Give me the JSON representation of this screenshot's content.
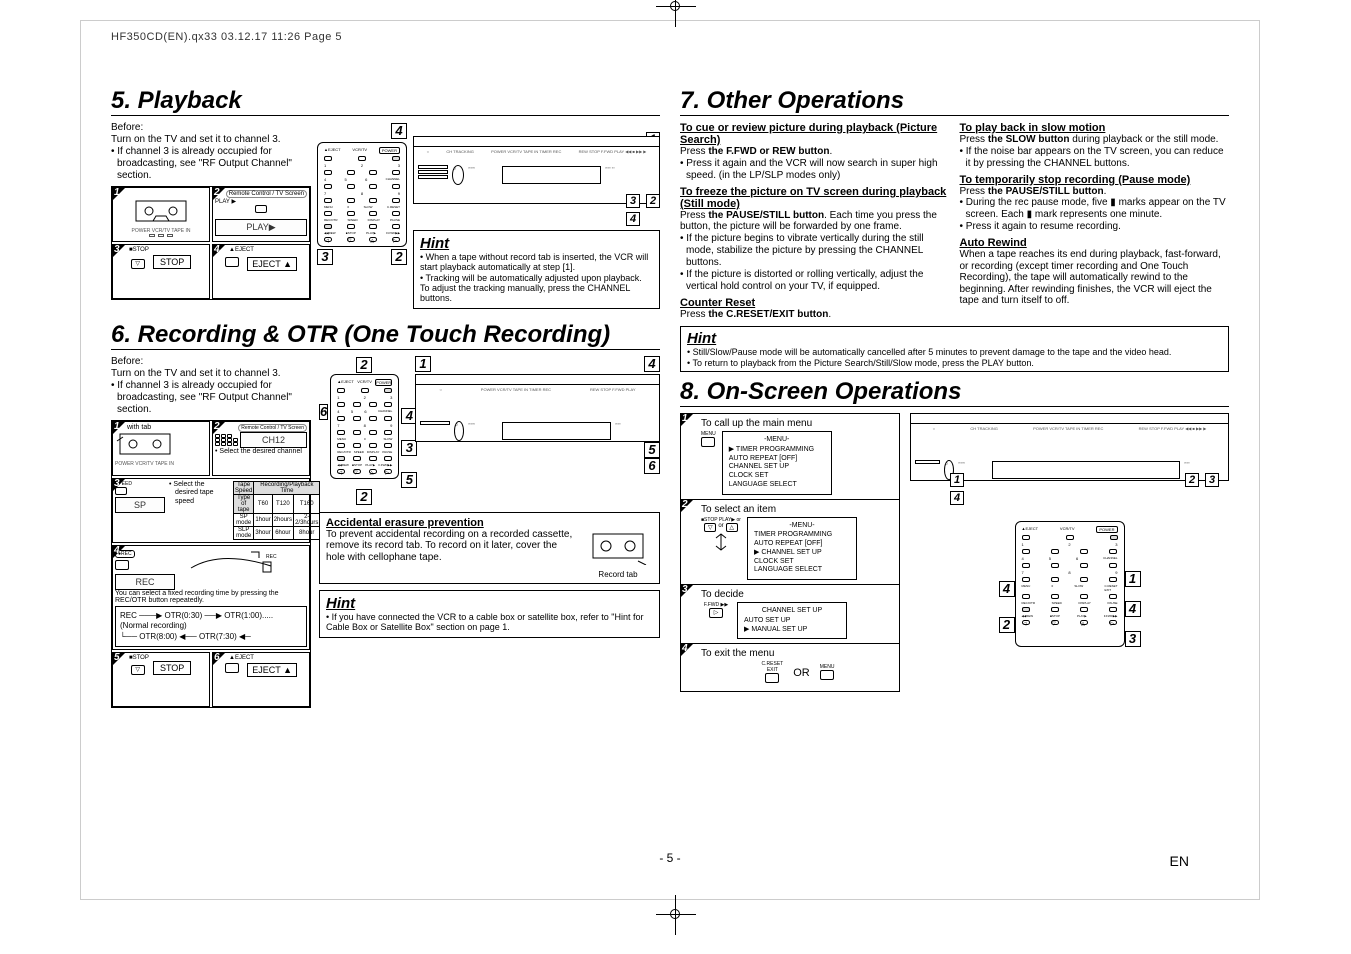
{
  "header": "HF350CD(EN).qx33  03.12.17 11:26  Page 5",
  "section5": {
    "title": "5. Playback",
    "before": "Before:\nTurn on the TV and set it to channel 3.",
    "before_note": "• If channel 3 is already occupied for broadcasting, see \"RF Output Channel\" section.",
    "steps": {
      "s1_label": "1",
      "s2_label": "2",
      "s2_text": "PLAY▶",
      "s2_hint": "Remote Control / TV Screen",
      "s2_small": "PLAY ▶",
      "s3_label": "3",
      "s3_text": "STOP",
      "s3_small": "■STOP",
      "s4_label": "4",
      "s4_text": "EJECT ▲",
      "s4_small": "▲EJECT"
    },
    "hint_title": "Hint",
    "hint1": "• When a tape without record tab is inserted, the VCR will start playback automatically at step [1].",
    "hint2": "• Tracking will be automatically adjusted upon playback. To adjust the tracking manually, press the CHANNEL buttons.",
    "vcr_badges": {
      "tl": "1",
      "r1": "3",
      "r2": "2",
      "bl": "3",
      "br": "4",
      "mid": "2",
      "remote": "4"
    },
    "vcr_labels": "POWER  VCR/TV TAPE IN  TIMER  REC"
  },
  "section6": {
    "title": "6. Recording & OTR (One Touch Recording)",
    "before": "Before:\nTurn on the TV and set it to channel 3.",
    "before_note": "• If channel 3 is already occupied for broadcasting, see \"RF Output Channel\" section.",
    "steps": {
      "s1": {
        "n": "1",
        "text": "with tab"
      },
      "s2": {
        "n": "2",
        "text": "CH12",
        "hint": "Remote Control / TV Screen",
        "note": "• Select the desired channel"
      },
      "s3": {
        "n": "3",
        "text": "SP",
        "small": "SPEED",
        "note": "• Select the desired tape speed"
      },
      "s4": {
        "n": "4",
        "text": "REC",
        "small": "●REC",
        "note": "You can select a fixed recording time by pressing the REC/OTR button repeatedly.",
        "flow": "REC ───▶ OTR(0:30) ──▶ OTR(1:00).....\n(Normal recording)\n└── OTR(8:00) ◀── OTR(7:30) ◀─"
      },
      "s5": {
        "n": "5",
        "text": "STOP",
        "small": "■STOP"
      },
      "s6": {
        "n": "6",
        "text": "EJECT ▲",
        "small": "▲EJECT"
      }
    },
    "tape_table": {
      "h1": "Tape Speed",
      "h2": "Recording/Playback Time",
      "r1": [
        "Type of tape",
        "T60",
        "T120",
        "T160"
      ],
      "r2": [
        "SP  mode",
        "1hour",
        "2hours",
        "2-2/3hours"
      ],
      "r3": [
        "SLP mode",
        "3hour",
        "6hour",
        "8hour"
      ]
    },
    "acc_title": "Accidental erasure prevention",
    "acc_body": "To prevent accidental recording on a recorded cassette, remove its record tab. To record on it later, cover the hole with cellophane tape.",
    "acc_caption": "Record tab",
    "hint_title": "Hint",
    "hint": "• If you have connected the VCR to a cable box or satellite box, refer to \"Hint for Cable Box or Satellite Box\" section on page 1.",
    "r_badges": {
      "top": "2",
      "mid_l": "6",
      "mid_r": "4",
      "low": "3",
      "b": "5",
      "v1": "1",
      "v4": "4",
      "v2": "2",
      "v5": "5",
      "v6": "6"
    }
  },
  "section7": {
    "title": "7. Other Operations",
    "cue_head": "To cue or review picture during playback (Picture Search)",
    "cue_b1": "Press the F.FWD or REW button.",
    "cue_b2": "• Press it again and the VCR will now search in super high speed. (in the LP/SLP modes only)",
    "freeze_head": "To freeze the picture on TV screen during playback (Still mode)",
    "freeze_b1": "Press the PAUSE/STILL button. Each time you press the button, the picture will be forwarded by one frame.",
    "freeze_b2": "• If the picture begins to vibrate vertically during the still mode, stabilize the picture by pressing the CHANNEL buttons.",
    "freeze_b3": "• If the picture is distorted or rolling vertically, adjust the vertical hold control on your TV, if equipped.",
    "counter_head": "Counter Reset",
    "counter_b": "Press the C.RESET/EXIT button.",
    "slow_head": "To play back in slow motion",
    "slow_b1": "Press the SLOW button during playback or the still mode.",
    "slow_b2": "• If the noise bar appears on the TV screen, you can reduce it by pressing the CHANNEL buttons.",
    "pause_head": "To temporarily stop recording (Pause mode)",
    "pause_b1": "Press the PAUSE/STILL button.",
    "pause_b2": "• During the rec pause mode, five ▮ marks appear on the TV screen. Each ▮ mark represents one minute.",
    "pause_b3": "• Press it again to resume recording.",
    "auto_head": "Auto Rewind",
    "auto_b": "When a tape reaches its end during playback, fast-forward, or recording (except timer recording and One Touch Recording), the tape will automatically rewind to the beginning. After rewinding finishes, the VCR will eject the tape and turn itself to off.",
    "hint_title": "Hint",
    "hint1": "• Still/Slow/Pause mode will be automatically cancelled after 5 minutes to prevent damage to the tape and the video head.",
    "hint2": "• To return to playback from the Picture Search/Still/Slow mode, press the PLAY button."
  },
  "section8": {
    "title": "8. On-Screen Operations",
    "steps": {
      "s1": {
        "n": "1",
        "title": "To call up the main menu",
        "small": "MENU",
        "menu_title": "-MENU-",
        "menu": [
          "▶ TIMER PROGRAMMING",
          "   AUTO REPEAT   [OFF]",
          "   CHANNEL SET UP",
          "   CLOCK SET",
          "   LANGUAGE SELECT"
        ]
      },
      "s2": {
        "n": "2",
        "title": "To select an item",
        "small": "■STOP   PLAY▶   or",
        "menu_title": "-MENU-",
        "menu": [
          "   TIMER PROGRAMMING",
          "   AUTO REPEAT   [OFF]",
          "▶ CHANNEL SET UP",
          "   CLOCK SET",
          "   LANGUAGE SELECT"
        ]
      },
      "s3": {
        "n": "3",
        "title": "To decide",
        "small": "F.FWD ▶▶",
        "menu_title": "CHANNEL SET UP",
        "menu": [
          "   AUTO SET UP",
          "▶ MANUAL SET UP"
        ]
      },
      "s4": {
        "n": "4",
        "title": "To exit the menu",
        "small": "C.RESET/EXIT       MENU",
        "body": "OR"
      }
    },
    "vcr_badges": {
      "a": "1",
      "b": "2",
      "c": "3",
      "d": "4"
    },
    "remote_badges": {
      "l4": "4",
      "l2": "2",
      "r1": "1",
      "r4": "4",
      "r3": "3"
    }
  },
  "pagefoot": "- 5 -",
  "en": "EN"
}
